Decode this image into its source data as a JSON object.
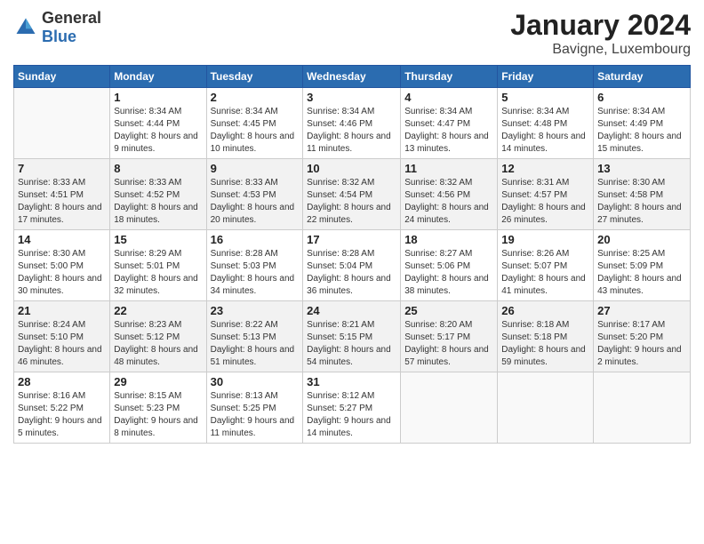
{
  "header": {
    "logo_general": "General",
    "logo_blue": "Blue",
    "month_year": "January 2024",
    "location": "Bavigne, Luxembourg"
  },
  "weekdays": [
    "Sunday",
    "Monday",
    "Tuesday",
    "Wednesday",
    "Thursday",
    "Friday",
    "Saturday"
  ],
  "weeks": [
    [
      {
        "day": "",
        "sunrise": "",
        "sunset": "",
        "daylight": ""
      },
      {
        "day": "1",
        "sunrise": "Sunrise: 8:34 AM",
        "sunset": "Sunset: 4:44 PM",
        "daylight": "Daylight: 8 hours and 9 minutes."
      },
      {
        "day": "2",
        "sunrise": "Sunrise: 8:34 AM",
        "sunset": "Sunset: 4:45 PM",
        "daylight": "Daylight: 8 hours and 10 minutes."
      },
      {
        "day": "3",
        "sunrise": "Sunrise: 8:34 AM",
        "sunset": "Sunset: 4:46 PM",
        "daylight": "Daylight: 8 hours and 11 minutes."
      },
      {
        "day": "4",
        "sunrise": "Sunrise: 8:34 AM",
        "sunset": "Sunset: 4:47 PM",
        "daylight": "Daylight: 8 hours and 13 minutes."
      },
      {
        "day": "5",
        "sunrise": "Sunrise: 8:34 AM",
        "sunset": "Sunset: 4:48 PM",
        "daylight": "Daylight: 8 hours and 14 minutes."
      },
      {
        "day": "6",
        "sunrise": "Sunrise: 8:34 AM",
        "sunset": "Sunset: 4:49 PM",
        "daylight": "Daylight: 8 hours and 15 minutes."
      }
    ],
    [
      {
        "day": "7",
        "sunrise": "Sunrise: 8:33 AM",
        "sunset": "Sunset: 4:51 PM",
        "daylight": "Daylight: 8 hours and 17 minutes."
      },
      {
        "day": "8",
        "sunrise": "Sunrise: 8:33 AM",
        "sunset": "Sunset: 4:52 PM",
        "daylight": "Daylight: 8 hours and 18 minutes."
      },
      {
        "day": "9",
        "sunrise": "Sunrise: 8:33 AM",
        "sunset": "Sunset: 4:53 PM",
        "daylight": "Daylight: 8 hours and 20 minutes."
      },
      {
        "day": "10",
        "sunrise": "Sunrise: 8:32 AM",
        "sunset": "Sunset: 4:54 PM",
        "daylight": "Daylight: 8 hours and 22 minutes."
      },
      {
        "day": "11",
        "sunrise": "Sunrise: 8:32 AM",
        "sunset": "Sunset: 4:56 PM",
        "daylight": "Daylight: 8 hours and 24 minutes."
      },
      {
        "day": "12",
        "sunrise": "Sunrise: 8:31 AM",
        "sunset": "Sunset: 4:57 PM",
        "daylight": "Daylight: 8 hours and 26 minutes."
      },
      {
        "day": "13",
        "sunrise": "Sunrise: 8:30 AM",
        "sunset": "Sunset: 4:58 PM",
        "daylight": "Daylight: 8 hours and 27 minutes."
      }
    ],
    [
      {
        "day": "14",
        "sunrise": "Sunrise: 8:30 AM",
        "sunset": "Sunset: 5:00 PM",
        "daylight": "Daylight: 8 hours and 30 minutes."
      },
      {
        "day": "15",
        "sunrise": "Sunrise: 8:29 AM",
        "sunset": "Sunset: 5:01 PM",
        "daylight": "Daylight: 8 hours and 32 minutes."
      },
      {
        "day": "16",
        "sunrise": "Sunrise: 8:28 AM",
        "sunset": "Sunset: 5:03 PM",
        "daylight": "Daylight: 8 hours and 34 minutes."
      },
      {
        "day": "17",
        "sunrise": "Sunrise: 8:28 AM",
        "sunset": "Sunset: 5:04 PM",
        "daylight": "Daylight: 8 hours and 36 minutes."
      },
      {
        "day": "18",
        "sunrise": "Sunrise: 8:27 AM",
        "sunset": "Sunset: 5:06 PM",
        "daylight": "Daylight: 8 hours and 38 minutes."
      },
      {
        "day": "19",
        "sunrise": "Sunrise: 8:26 AM",
        "sunset": "Sunset: 5:07 PM",
        "daylight": "Daylight: 8 hours and 41 minutes."
      },
      {
        "day": "20",
        "sunrise": "Sunrise: 8:25 AM",
        "sunset": "Sunset: 5:09 PM",
        "daylight": "Daylight: 8 hours and 43 minutes."
      }
    ],
    [
      {
        "day": "21",
        "sunrise": "Sunrise: 8:24 AM",
        "sunset": "Sunset: 5:10 PM",
        "daylight": "Daylight: 8 hours and 46 minutes."
      },
      {
        "day": "22",
        "sunrise": "Sunrise: 8:23 AM",
        "sunset": "Sunset: 5:12 PM",
        "daylight": "Daylight: 8 hours and 48 minutes."
      },
      {
        "day": "23",
        "sunrise": "Sunrise: 8:22 AM",
        "sunset": "Sunset: 5:13 PM",
        "daylight": "Daylight: 8 hours and 51 minutes."
      },
      {
        "day": "24",
        "sunrise": "Sunrise: 8:21 AM",
        "sunset": "Sunset: 5:15 PM",
        "daylight": "Daylight: 8 hours and 54 minutes."
      },
      {
        "day": "25",
        "sunrise": "Sunrise: 8:20 AM",
        "sunset": "Sunset: 5:17 PM",
        "daylight": "Daylight: 8 hours and 57 minutes."
      },
      {
        "day": "26",
        "sunrise": "Sunrise: 8:18 AM",
        "sunset": "Sunset: 5:18 PM",
        "daylight": "Daylight: 8 hours and 59 minutes."
      },
      {
        "day": "27",
        "sunrise": "Sunrise: 8:17 AM",
        "sunset": "Sunset: 5:20 PM",
        "daylight": "Daylight: 9 hours and 2 minutes."
      }
    ],
    [
      {
        "day": "28",
        "sunrise": "Sunrise: 8:16 AM",
        "sunset": "Sunset: 5:22 PM",
        "daylight": "Daylight: 9 hours and 5 minutes."
      },
      {
        "day": "29",
        "sunrise": "Sunrise: 8:15 AM",
        "sunset": "Sunset: 5:23 PM",
        "daylight": "Daylight: 9 hours and 8 minutes."
      },
      {
        "day": "30",
        "sunrise": "Sunrise: 8:13 AM",
        "sunset": "Sunset: 5:25 PM",
        "daylight": "Daylight: 9 hours and 11 minutes."
      },
      {
        "day": "31",
        "sunrise": "Sunrise: 8:12 AM",
        "sunset": "Sunset: 5:27 PM",
        "daylight": "Daylight: 9 hours and 14 minutes."
      },
      {
        "day": "",
        "sunrise": "",
        "sunset": "",
        "daylight": ""
      },
      {
        "day": "",
        "sunrise": "",
        "sunset": "",
        "daylight": ""
      },
      {
        "day": "",
        "sunrise": "",
        "sunset": "",
        "daylight": ""
      }
    ]
  ]
}
